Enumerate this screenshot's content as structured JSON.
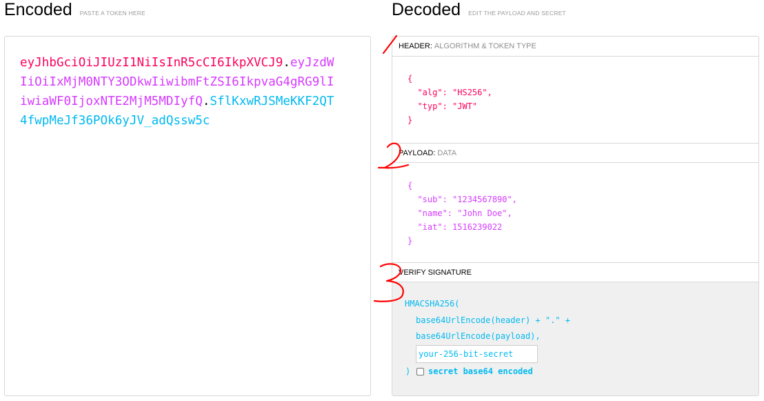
{
  "encoded": {
    "title": "Encoded",
    "subtitle": "PASTE A TOKEN HERE",
    "token_header": "eyJhbGciOiJIUzI1NiIsInR5cCI6IkpXVCJ9",
    "token_payload": "eyJzdWIiOiIxMjM0NTY3ODkwIiwibmFtZSI6IkpvaG4gRG9lIiwiaWF0IjoxNTE2MjM5MDIyfQ",
    "token_signature": "SflKxwRJSMeKKF2QT4fwpMeJf36POk6yJV_adQssw5c",
    "dot": "."
  },
  "decoded": {
    "title": "Decoded",
    "subtitle": "EDIT THE PAYLOAD AND SECRET",
    "header_label": "HEADER:",
    "header_sub": "ALGORITHM & TOKEN TYPE",
    "header_json": "{\n  \"alg\": \"HS256\",\n  \"typ\": \"JWT\"\n}",
    "payload_label": "PAYLOAD:",
    "payload_sub": "DATA",
    "payload_json": "{\n  \"sub\": \"1234567890\",\n  \"name\": \"John Doe\",\n  \"iat\": 1516239022\n}",
    "verify_label": "VERIFY SIGNATURE",
    "sig_line1": "HMACSHA256(",
    "sig_line2": "base64UrlEncode(header) + \".\" +",
    "sig_line3": "base64UrlEncode(payload),",
    "secret_placeholder": "your-256-bit-secret",
    "sig_close": ")",
    "checkbox_label": "secret base64 encoded"
  },
  "annotations": {
    "marks": [
      "1",
      "2",
      "3"
    ],
    "color": "#ff0000"
  },
  "colors": {
    "header": "#fb015b",
    "payload": "#d63aff",
    "signature": "#00b9f1"
  }
}
